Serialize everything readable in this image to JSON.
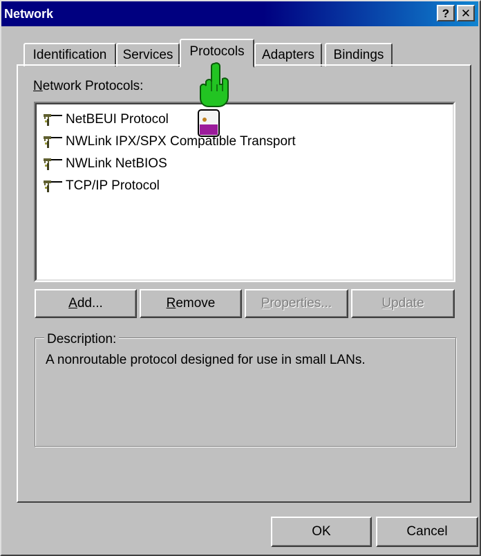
{
  "window": {
    "title": "Network",
    "help_glyph": "?",
    "close_glyph": "✕"
  },
  "tabs": [
    {
      "label": "Identification"
    },
    {
      "label": "Services"
    },
    {
      "label": "Protocols"
    },
    {
      "label": "Adapters"
    },
    {
      "label": "Bindings"
    }
  ],
  "network_protocols": {
    "label_mnemonic": "N",
    "label_rest": "etwork Protocols:",
    "items": [
      {
        "label": "NetBEUI Protocol",
        "icon": "network-protocol-icon"
      },
      {
        "label": "NWLink IPX/SPX Compatible Transport",
        "icon": "network-protocol-icon"
      },
      {
        "label": "NWLink NetBIOS",
        "icon": "network-protocol-icon"
      },
      {
        "label": "TCP/IP Protocol",
        "icon": "network-protocol-icon"
      }
    ]
  },
  "buttons": {
    "add": {
      "mnemonic": "A",
      "rest": "dd..."
    },
    "remove": {
      "mnemonic": "R",
      "rest": "emove"
    },
    "properties": {
      "mnemonic": "P",
      "rest": "roperties..."
    },
    "update": {
      "mnemonic": "U",
      "rest": "pdate"
    },
    "ok": "OK",
    "cancel": "Cancel"
  },
  "description": {
    "legend": "Description:",
    "text": "A nonroutable protocol designed for use in small LANs."
  },
  "colors": {
    "title_bar": "#000080",
    "face": "#c0c0c0",
    "cursor_hand": "#22c422"
  }
}
